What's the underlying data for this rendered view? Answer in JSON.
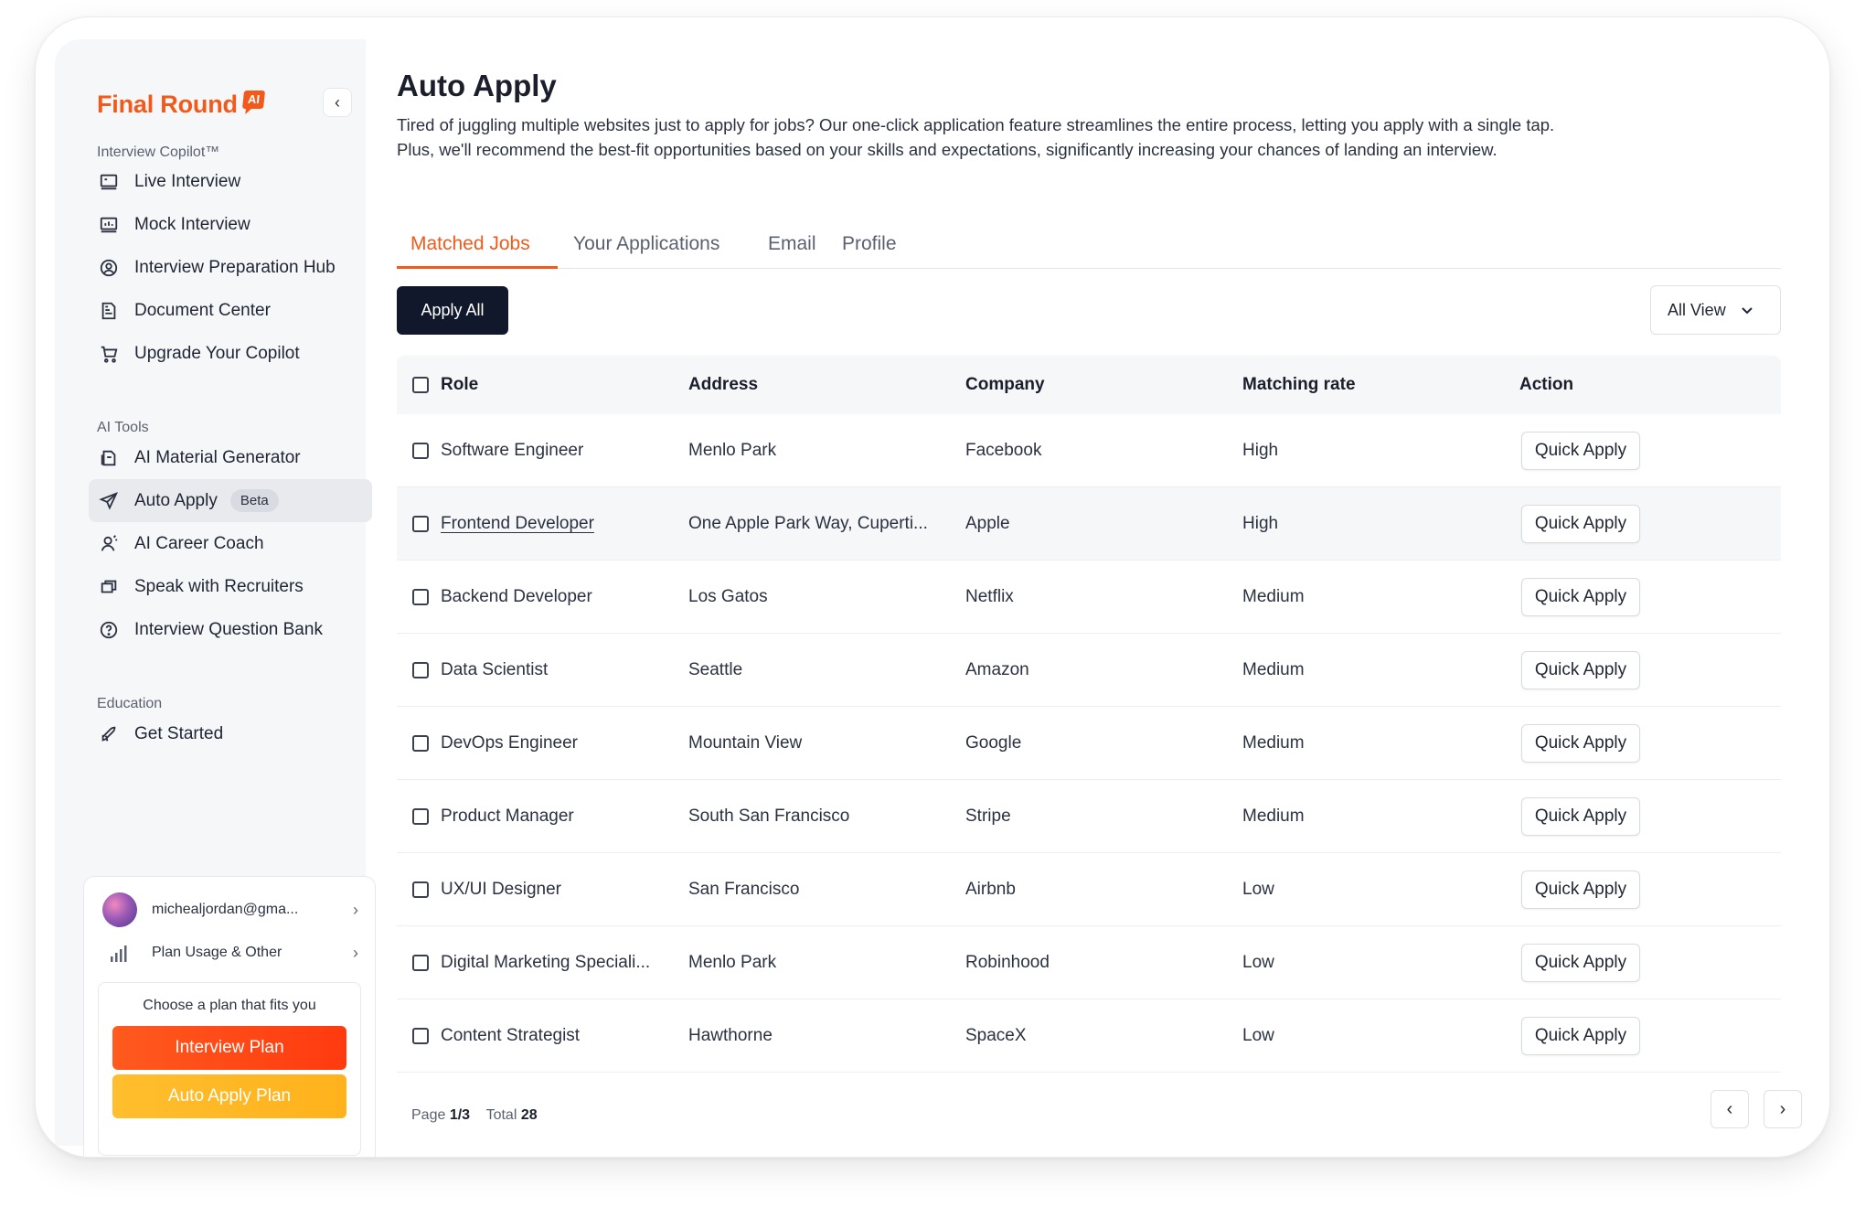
{
  "brand": {
    "name": "Final Round",
    "badge": "AI",
    "color": "#f25a1b"
  },
  "sidebar": {
    "sections": [
      {
        "label": "Interview Copilot™"
      },
      {
        "label": "AI Tools"
      },
      {
        "label": "Education"
      }
    ],
    "items": [
      {
        "label": "Live Interview",
        "icon": "monitor-icon"
      },
      {
        "label": "Mock Interview",
        "icon": "presentation-icon"
      },
      {
        "label": "Interview Preparation Hub",
        "icon": "user-circle-icon"
      },
      {
        "label": "Document Center",
        "icon": "document-icon"
      },
      {
        "label": "Upgrade Your Copilot",
        "icon": "cart-icon"
      },
      {
        "label": "AI Material Generator",
        "icon": "material-icon"
      },
      {
        "label": "Auto Apply",
        "icon": "send-icon",
        "badge": "Beta",
        "active": true
      },
      {
        "label": "AI Career Coach",
        "icon": "coach-icon"
      },
      {
        "label": "Speak with Recruiters",
        "icon": "chat-icon"
      },
      {
        "label": "Interview Question Bank",
        "icon": "question-icon"
      },
      {
        "label": "Get Started",
        "icon": "rocket-icon"
      }
    ],
    "user": {
      "email": "michealjordan@gma...",
      "plan_usage": "Plan Usage & Other"
    },
    "plan_box": {
      "title": "Choose a plan that fits you",
      "interview_plan": "Interview Plan",
      "auto_apply_plan": "Auto Apply Plan"
    }
  },
  "main": {
    "title": "Auto Apply",
    "description": "Tired of juggling multiple websites just to apply for jobs? Our one-click application feature streamlines the entire process, letting you apply with a single tap. Plus, we'll recommend the best-fit opportunities based on your skills and expectations, significantly increasing your chances of landing an interview.",
    "tabs": [
      {
        "label": "Matched Jobs",
        "active": true
      },
      {
        "label": "Your Applications"
      },
      {
        "label": "Email"
      },
      {
        "label": "Profile"
      }
    ],
    "apply_all_label": "Apply All",
    "view_select": "All View",
    "table": {
      "headers": [
        "Role",
        "Address",
        "Company",
        "Matching rate",
        "Action"
      ],
      "action_label": "Quick Apply",
      "rows": [
        {
          "role": "Software Engineer",
          "address": "Menlo Park",
          "company": "Facebook",
          "rate": "High"
        },
        {
          "role": "Frontend Developer",
          "address": "One Apple Park Way, Cuperti...",
          "company": "Apple",
          "rate": "High"
        },
        {
          "role": "Backend Developer",
          "address": "Los Gatos",
          "company": "Netflix",
          "rate": "Medium"
        },
        {
          "role": "Data Scientist",
          "address": "Seattle",
          "company": "Amazon",
          "rate": "Medium"
        },
        {
          "role": "DevOps Engineer",
          "address": "Mountain View",
          "company": "Google",
          "rate": "Medium"
        },
        {
          "role": "Product Manager",
          "address": "South San Francisco",
          "company": "Stripe",
          "rate": "Medium"
        },
        {
          "role": "UX/UI Designer",
          "address": "San Francisco",
          "company": "Airbnb",
          "rate": "Low"
        },
        {
          "role": "Digital Marketing Speciali...",
          "address": "Menlo Park",
          "company": "Robinhood",
          "rate": "Low"
        },
        {
          "role": "Content Strategist",
          "address": "Hawthorne",
          "company": "SpaceX",
          "rate": "Low"
        }
      ]
    },
    "pagination": {
      "page_label": "Page",
      "page_value": "1/3",
      "total_label": "Total",
      "total_value": "28"
    }
  }
}
